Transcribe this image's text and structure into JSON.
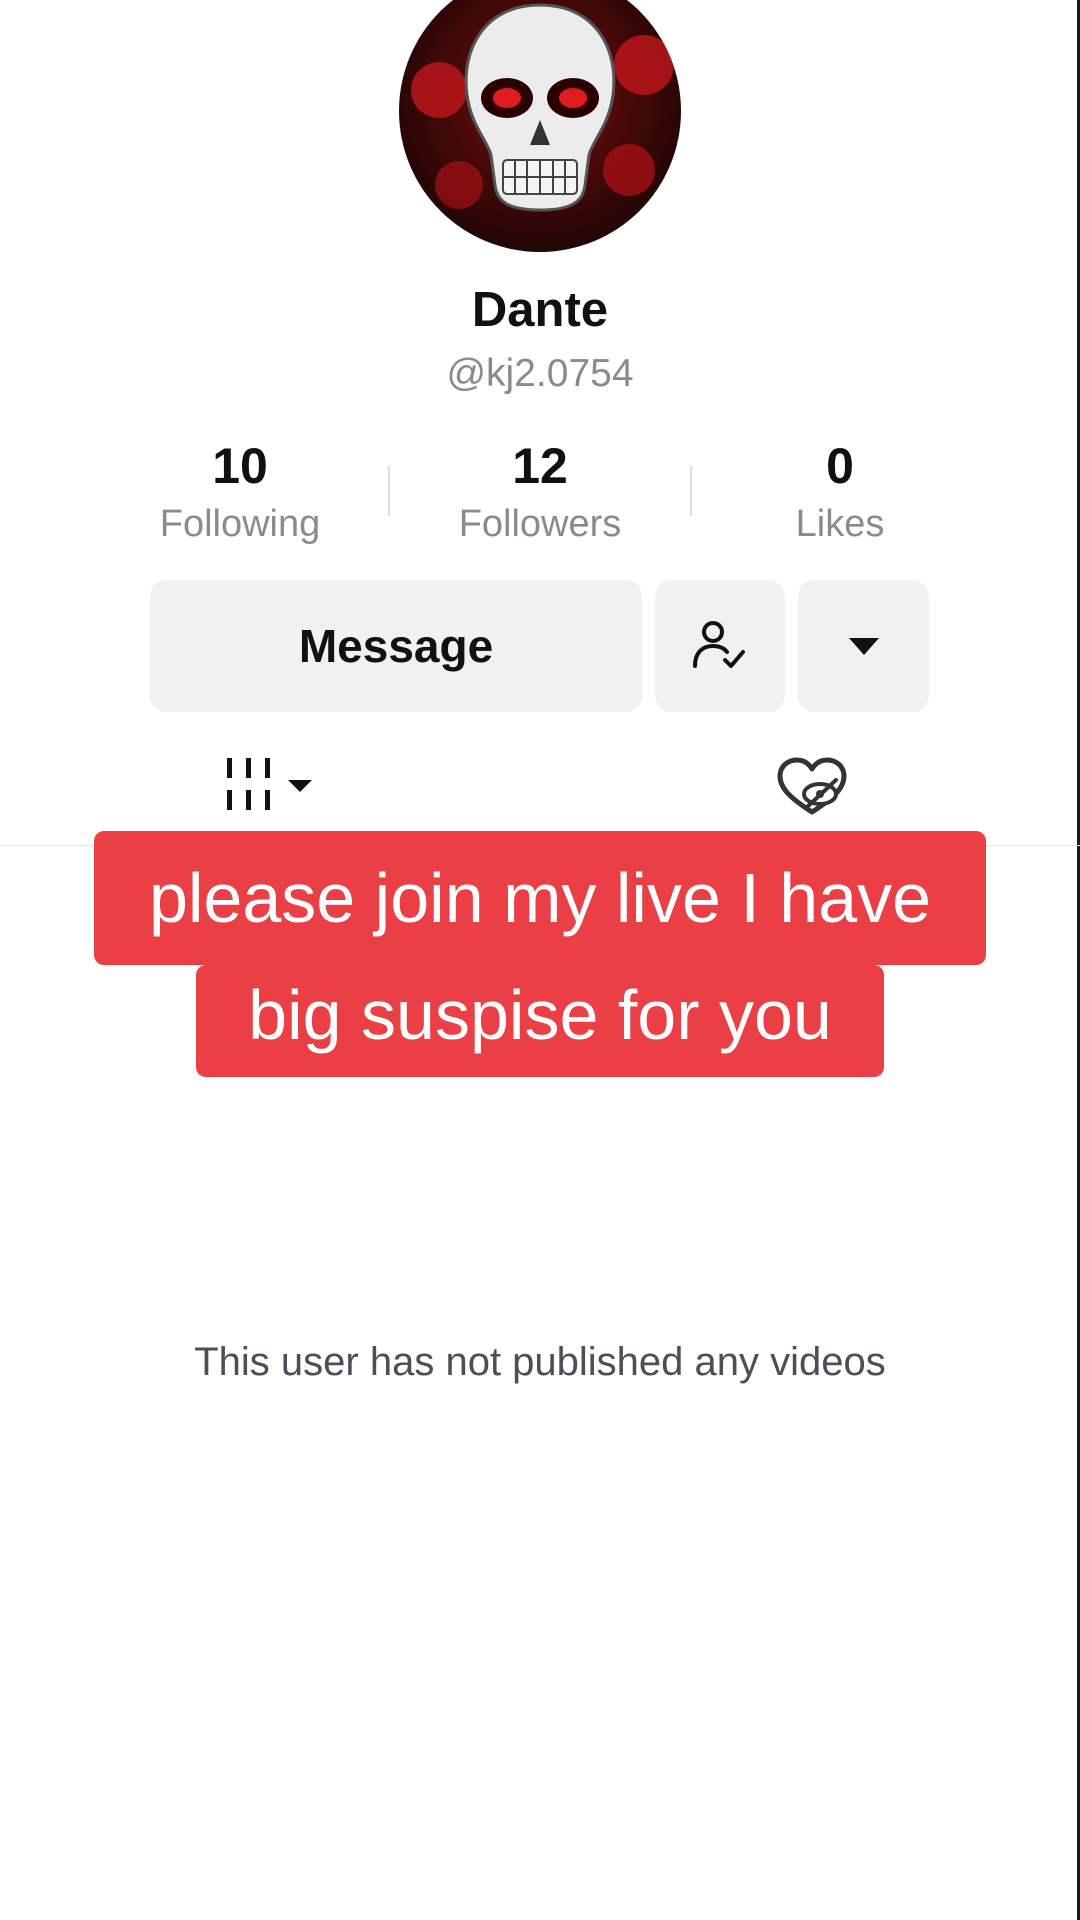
{
  "profile": {
    "display_name": "Dante",
    "username": "@kj2.0754",
    "avatar_icon": "skull-avatar"
  },
  "stats": [
    {
      "value": "10",
      "label": "Following"
    },
    {
      "value": "12",
      "label": "Followers"
    },
    {
      "value": "0",
      "label": "Likes"
    }
  ],
  "actions": {
    "message_label": "Message",
    "follow_icon": "user-check-icon",
    "more_icon": "caret-down-icon"
  },
  "tabs": {
    "videos_icon": "videos-grid-icon",
    "liked_icon": "liked-hidden-icon"
  },
  "overlay": {
    "line1": "please join my live I have",
    "line2": "big suspise for you"
  },
  "empty_state": {
    "text": "This user has not published any videos"
  },
  "colors": {
    "banner": "#ea4045",
    "button_bg": "#f1f1f2",
    "secondary_text": "#8a8b91"
  }
}
